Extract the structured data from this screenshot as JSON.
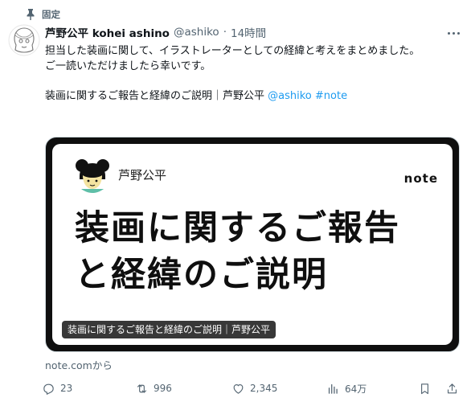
{
  "pinned_label": "固定",
  "author": {
    "name": "芦野公平 kohei ashino",
    "handle": "@ashiko",
    "separator": "·",
    "time": "14時間"
  },
  "tweet": {
    "line1": "担当した装画に関して、イラストレーターとしての経緯と考えをまとめました。",
    "line2": "ご一読いただけましたら幸いです。",
    "line3": "",
    "line4_prefix": "装画に関するご報告と経緯のご説明｜芦野公平 ",
    "mention": "@ashiko",
    "hashtag": "#note"
  },
  "card": {
    "author": "芦野公平",
    "logo": "note",
    "title_line1": "装画に関するご報告",
    "title_line2": "と経緯のご説明",
    "caption": "装画に関するご報告と経緯のご説明｜芦野公平"
  },
  "source": "note.comから",
  "actions": {
    "reply_icon": "reply-icon",
    "replies": "23",
    "retweet_icon": "retweet-icon",
    "retweets": "996",
    "like_icon": "heart-icon",
    "likes": "2,345",
    "views_icon": "views-icon",
    "views": "64万",
    "bookmark_icon": "bookmark-icon",
    "share_icon": "share-icon"
  },
  "colors": {
    "link": "#1d9bf0",
    "secondary_text": "#536471",
    "primary_text": "#0f1419",
    "border": "#cfd9de"
  }
}
